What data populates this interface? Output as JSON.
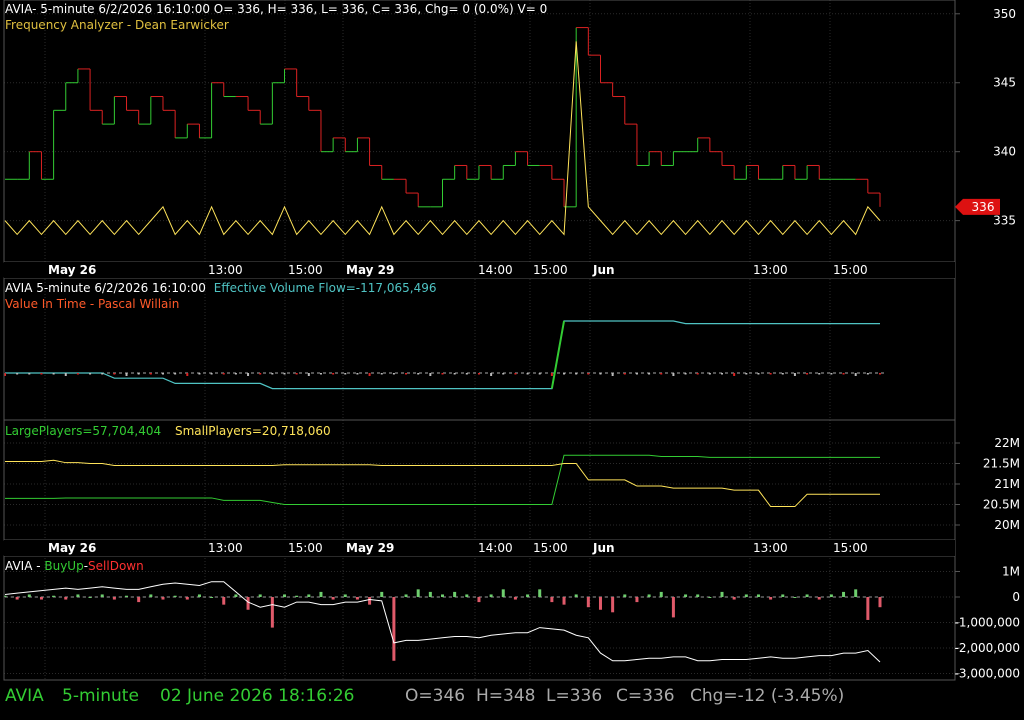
{
  "colors": {
    "bg": "#000000",
    "grid": "#2a2a2a",
    "axis": "#555555",
    "up": "#33cc33",
    "down": "#dd2222",
    "yellow": "#ffe45a",
    "cyan": "#4fc3c3",
    "white": "#ffffff",
    "orange": "#ff5a2a",
    "green_title": "#33cc33",
    "yellow_title": "#e0c040"
  },
  "panel1": {
    "header": "AVIA- 5-minute 6/2/2026 16:10:00 O= 336, H= 336, L= 336, C= 336, Chg= 0 (0.0%) V= 0",
    "indicator": "Frequency Analyzer - Dean Earwicker",
    "price_tag": "336",
    "yticks": [
      "350",
      "345",
      "340",
      "335"
    ]
  },
  "time_axis": {
    "labels": [
      "May 26",
      "13:00",
      "15:00",
      "May 29",
      "14:00",
      "15:00",
      "Jun",
      "13:00",
      "15:00"
    ],
    "bold": [
      true,
      false,
      false,
      true,
      false,
      false,
      true,
      false,
      false
    ]
  },
  "panel2": {
    "symbol_line": "AVIA 5-minute  6/2/2026 16:10:00",
    "indicator": "Effective Volume Flow=-117,065,496",
    "subtitle": "Value In Time - Pascal Willain"
  },
  "panel3": {
    "large": "LargePlayers=57,704,404",
    "small": "SmallPlayers=20,718,060",
    "yticks": [
      "22M",
      "21.5M",
      "21M",
      "20.5M",
      "20M"
    ]
  },
  "panel4": {
    "prefix": "AVIA - ",
    "buyup": "BuyUp",
    "dash": "-",
    "selldown": "SellDown",
    "yticks": [
      "1M",
      "0",
      "-1,000,000",
      "-2,000,000",
      "-3,000,000"
    ]
  },
  "status": {
    "symbol": "AVIA",
    "interval": "5-minute",
    "datetime": "02 June 2026 18:16:26",
    "o": "O=346",
    "h": "H=348",
    "l": "L=336",
    "c": "C=336",
    "chg": "Chg=-12 (-3.45%)"
  },
  "chart_data": [
    {
      "type": "line",
      "name": "price step (Frequency Analyzer)",
      "ylim": [
        332,
        351
      ],
      "values": [
        338,
        338,
        340,
        338,
        343,
        345,
        346,
        343,
        342,
        344,
        343,
        342,
        344,
        343,
        341,
        342,
        341,
        345,
        344,
        344,
        343,
        342,
        345,
        346,
        344,
        343,
        340,
        341,
        340,
        341,
        339,
        338,
        338,
        337,
        336,
        336,
        338,
        339,
        338,
        339,
        338,
        339,
        340,
        339,
        339,
        338,
        336,
        349,
        347,
        345,
        344,
        342,
        339,
        340,
        339,
        340,
        340,
        341,
        340,
        339,
        338,
        339,
        338,
        338,
        339,
        338,
        339,
        338,
        338,
        338,
        338,
        337,
        336
      ],
      "secondary_values": [
        335,
        334,
        335,
        334,
        335,
        334,
        335,
        334,
        335,
        334,
        335,
        334,
        335,
        336,
        334,
        335,
        334,
        336,
        334,
        335,
        334,
        335,
        334,
        336,
        334,
        335,
        334,
        335,
        334,
        335,
        334,
        336,
        334,
        335,
        334,
        335,
        334,
        335,
        334,
        335,
        334,
        335,
        334,
        335,
        334,
        335,
        334,
        348,
        336,
        335,
        334,
        335,
        334,
        335,
        334,
        335,
        334,
        335,
        334,
        335,
        334,
        335,
        334,
        335,
        334,
        335,
        334,
        335,
        334,
        335,
        334,
        336,
        335
      ]
    },
    {
      "type": "line",
      "name": "Effective Volume Flow",
      "values": [
        0,
        0,
        0,
        0,
        0,
        0,
        0,
        0,
        0,
        -0.1,
        -0.1,
        -0.1,
        -0.1,
        -0.1,
        -0.2,
        -0.2,
        -0.2,
        -0.2,
        -0.2,
        -0.2,
        -0.2,
        -0.2,
        -0.3,
        -0.3,
        -0.3,
        -0.3,
        -0.3,
        -0.3,
        -0.3,
        -0.3,
        -0.3,
        -0.3,
        -0.3,
        -0.3,
        -0.3,
        -0.3,
        -0.3,
        -0.3,
        -0.3,
        -0.3,
        -0.3,
        -0.3,
        -0.3,
        -0.3,
        -0.3,
        -0.3,
        1.0,
        1.0,
        1.0,
        1.0,
        1.0,
        1.0,
        1.0,
        1.0,
        1.0,
        1.0,
        0.95,
        0.95,
        0.95,
        0.95,
        0.95,
        0.95,
        0.95,
        0.95,
        0.95,
        0.95,
        0.95,
        0.95,
        0.95,
        0.95,
        0.95,
        0.95,
        0.95
      ]
    },
    {
      "type": "line",
      "name": "LargePlayers vs SmallPlayers",
      "large": [
        20.65,
        20.65,
        20.65,
        20.65,
        20.65,
        20.66,
        20.66,
        20.66,
        20.66,
        20.66,
        20.66,
        20.66,
        20.66,
        20.66,
        20.66,
        20.66,
        20.66,
        20.66,
        20.6,
        20.6,
        20.6,
        20.6,
        20.55,
        20.5,
        20.5,
        20.5,
        20.5,
        20.5,
        20.5,
        20.5,
        20.5,
        20.5,
        20.5,
        20.5,
        20.5,
        20.5,
        20.5,
        20.5,
        20.5,
        20.5,
        20.5,
        20.5,
        20.5,
        20.5,
        20.5,
        20.5,
        21.7,
        21.7,
        21.7,
        21.7,
        21.7,
        21.7,
        21.7,
        21.7,
        21.67,
        21.67,
        21.67,
        21.67,
        21.65,
        21.65,
        21.65,
        21.65,
        21.65,
        21.65,
        21.65,
        21.65,
        21.65,
        21.65,
        21.65,
        21.65,
        21.65,
        21.65,
        21.65
      ],
      "small": [
        21.55,
        21.55,
        21.55,
        21.55,
        21.58,
        21.52,
        21.52,
        21.5,
        21.5,
        21.45,
        21.45,
        21.45,
        21.45,
        21.45,
        21.45,
        21.45,
        21.45,
        21.45,
        21.45,
        21.45,
        21.45,
        21.45,
        21.45,
        21.47,
        21.47,
        21.47,
        21.47,
        21.47,
        21.47,
        21.47,
        21.47,
        21.45,
        21.45,
        21.45,
        21.45,
        21.45,
        21.45,
        21.45,
        21.45,
        21.45,
        21.45,
        21.45,
        21.45,
        21.45,
        21.45,
        21.45,
        21.5,
        21.5,
        21.1,
        21.1,
        21.1,
        21.1,
        20.95,
        20.95,
        20.95,
        20.9,
        20.9,
        20.9,
        20.9,
        20.9,
        20.85,
        20.85,
        20.85,
        20.45,
        20.45,
        20.45,
        20.75,
        20.75,
        20.75,
        20.75,
        20.75,
        20.75,
        20.75
      ]
    },
    {
      "type": "bar",
      "name": "BuyUp-SellDown",
      "ylim": [
        -3.2,
        1.6
      ],
      "bars": [
        0.05,
        -0.1,
        0.1,
        -0.1,
        0.05,
        -0.1,
        0.1,
        0.0,
        0.1,
        -0.1,
        0.05,
        -0.2,
        0.1,
        -0.1,
        0.05,
        -0.1,
        0.1,
        0.0,
        -0.3,
        0.1,
        -0.5,
        0.1,
        -1.2,
        0.1,
        0.05,
        0.1,
        0.2,
        -0.1,
        0.1,
        -0.1,
        -0.3,
        0.2,
        -2.5,
        0.1,
        0.3,
        0.2,
        0.1,
        0.2,
        0.1,
        -0.2,
        0.1,
        0.3,
        -0.1,
        0.1,
        0.3,
        -0.2,
        -0.3,
        0.1,
        -0.4,
        -0.5,
        -0.6,
        0.1,
        -0.2,
        0.1,
        0.2,
        -0.8,
        0.1,
        0.1,
        0.0,
        0.2,
        -0.1,
        0.1,
        0.1,
        -0.1,
        0.1,
        0.0,
        0.1,
        -0.1,
        0.1,
        0.2,
        0.3,
        -0.9,
        -0.4
      ],
      "line": [
        0.1,
        0.15,
        0.2,
        0.25,
        0.3,
        0.35,
        0.3,
        0.35,
        0.4,
        0.35,
        0.3,
        0.3,
        0.4,
        0.5,
        0.55,
        0.5,
        0.45,
        0.6,
        0.6,
        0.2,
        -0.2,
        -0.4,
        -0.3,
        -0.4,
        -0.2,
        -0.2,
        -0.3,
        -0.3,
        -0.2,
        -0.2,
        -0.1,
        -0.15,
        -1.8,
        -1.7,
        -1.7,
        -1.65,
        -1.6,
        -1.55,
        -1.55,
        -1.6,
        -1.5,
        -1.45,
        -1.4,
        -1.4,
        -1.2,
        -1.25,
        -1.3,
        -1.5,
        -1.6,
        -2.2,
        -2.5,
        -2.5,
        -2.45,
        -2.4,
        -2.4,
        -2.35,
        -2.35,
        -2.5,
        -2.5,
        -2.45,
        -2.45,
        -2.45,
        -2.4,
        -2.35,
        -2.4,
        -2.4,
        -2.35,
        -2.3,
        -2.3,
        -2.2,
        -2.2,
        -2.1,
        -2.55
      ]
    }
  ]
}
